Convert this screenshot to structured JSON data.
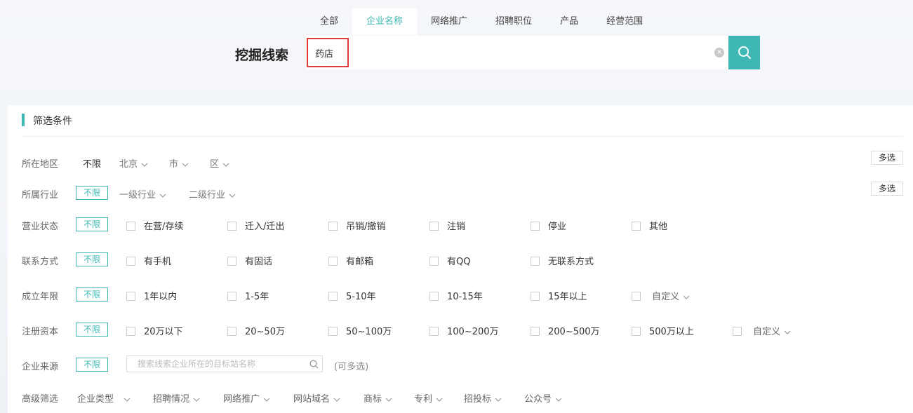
{
  "tabs": [
    "全部",
    "企业名称",
    "网络推广",
    "招聘职位",
    "产品",
    "经营范围"
  ],
  "active_tab": 1,
  "search": {
    "title": "挖掘线索",
    "value": "药店"
  },
  "panel_title": "筛选条件",
  "multi_label": "多选",
  "nolimit": "不限",
  "rows": {
    "region": {
      "label": "所在地区",
      "dropdowns": [
        "北京",
        "市",
        "区"
      ]
    },
    "industry": {
      "label": "所属行业",
      "dropdowns": [
        "一级行业",
        "二级行业"
      ]
    },
    "status": {
      "label": "营业状态",
      "options": [
        "在营/存续",
        "迁入/迁出",
        "吊销/撤销",
        "注销",
        "停业",
        "其他"
      ]
    },
    "contact": {
      "label": "联系方式",
      "options": [
        "有手机",
        "有固话",
        "有邮箱",
        "有QQ",
        "无联系方式"
      ]
    },
    "years": {
      "label": "成立年限",
      "options": [
        "1年以内",
        "1-5年",
        "5-10年",
        "10-15年",
        "15年以上"
      ],
      "custom": "自定义"
    },
    "capital": {
      "label": "注册资本",
      "options": [
        "20万以下",
        "20~50万",
        "50~100万",
        "100~200万",
        "200~500万",
        "500万以上"
      ],
      "custom": "自定义"
    },
    "source": {
      "label": "企业来源",
      "placeholder": "搜索线索企业所在的目标站名称",
      "hint": "(可多选)"
    },
    "advanced": {
      "label": "高级筛选",
      "dropdowns": [
        "企业类型",
        "招聘情况",
        "网络推广",
        "网站域名",
        "商标",
        "专利",
        "招投标",
        "公众号"
      ]
    }
  },
  "colors": {
    "accent": "#3fb8b5",
    "highlight": "#e03a3a"
  }
}
